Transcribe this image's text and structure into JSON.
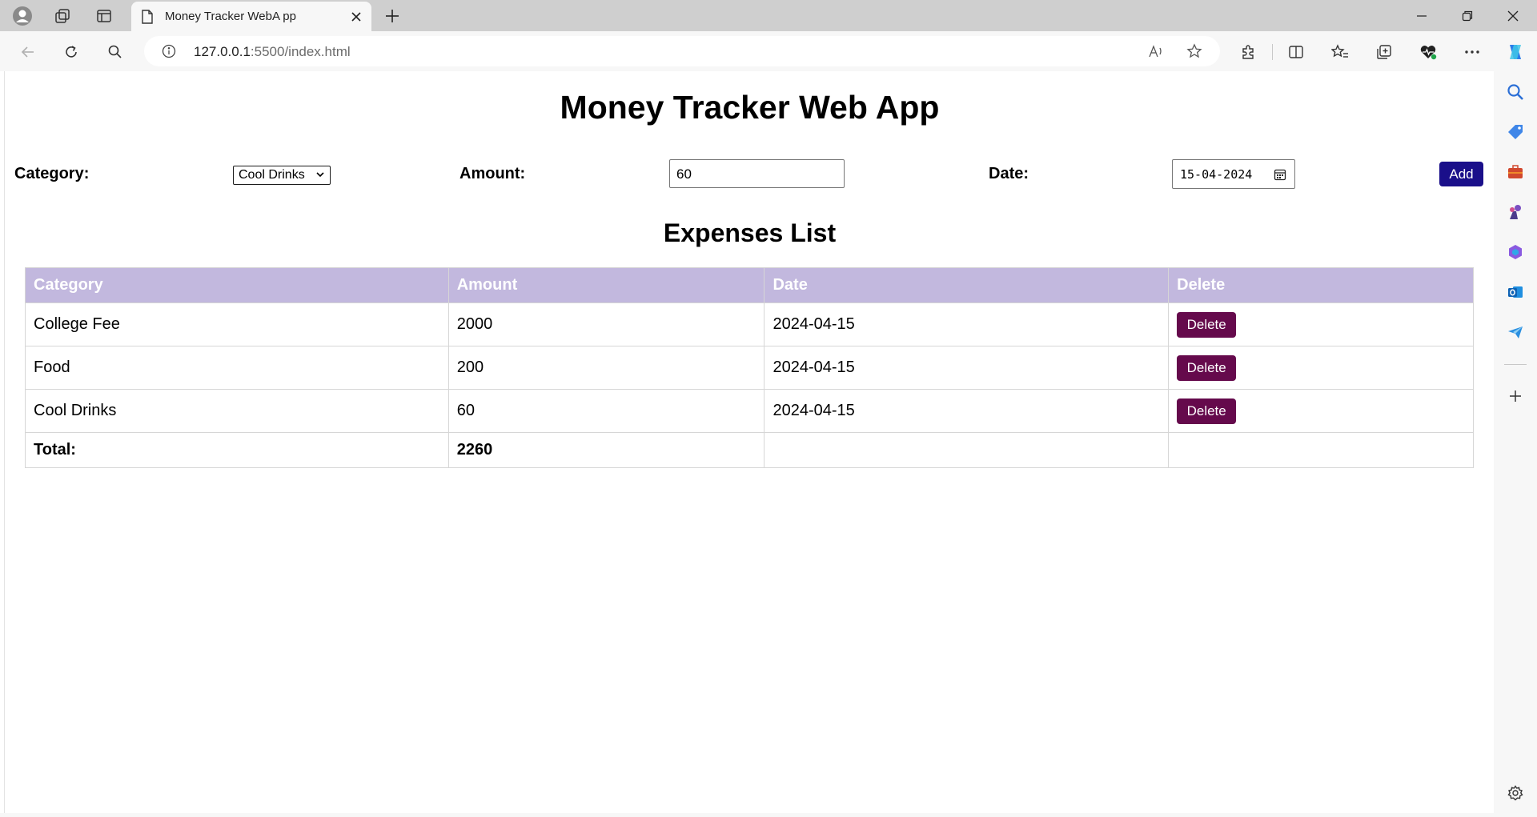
{
  "browser": {
    "tab_title": "Money Tracker WebA pp",
    "url_host": "127.0.0.1",
    "url_rest": ":5500/index.html"
  },
  "app": {
    "title": "Money Tracker Web App",
    "form": {
      "category_label": "Category:",
      "category_value": "Cool Drinks",
      "amount_label": "Amount:",
      "amount_value": "60",
      "date_label": "Date:",
      "date_value": "15-04-2024",
      "add_label": "Add"
    },
    "list_title": "Expenses List",
    "table": {
      "headers": [
        "Category",
        "Amount",
        "Date",
        "Delete"
      ],
      "rows": [
        {
          "category": "College Fee",
          "amount": "2000",
          "date": "2024-04-15",
          "delete_label": "Delete"
        },
        {
          "category": "Food",
          "amount": "200",
          "date": "2024-04-15",
          "delete_label": "Delete"
        },
        {
          "category": "Cool Drinks",
          "amount": "60",
          "date": "2024-04-15",
          "delete_label": "Delete"
        }
      ],
      "total_label": "Total:",
      "total_value": "2260"
    }
  },
  "colors": {
    "header_bg": "#c2b8de",
    "add_button": "#1a0f8a",
    "delete_button": "#650a4c"
  }
}
